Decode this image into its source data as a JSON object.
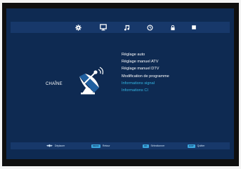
{
  "screen": {
    "section_label": "CHAÎNE"
  },
  "top_icons": [
    "settings-icon",
    "tv-icon",
    "music-icon",
    "clock-icon",
    "lock-icon",
    "input-source-icon"
  ],
  "menu": {
    "items": [
      {
        "label": "Réglage auto",
        "active": false
      },
      {
        "label": "Réglage manuel ATV",
        "active": false
      },
      {
        "label": "Réglage manuel DTV",
        "active": false
      },
      {
        "label": "Modification de programme",
        "active": false
      },
      {
        "label": "Informations signal",
        "active": true
      },
      {
        "label": "Informations CI",
        "active": true
      }
    ]
  },
  "footer": {
    "move_label": "Déplacer",
    "back_key": "MENU",
    "back_label": "Retour",
    "select_key": "OK",
    "select_label": "Sélectionner",
    "exit_key": "EXIT",
    "exit_label": "Quitter"
  },
  "colors": {
    "background": "#0e2a52",
    "bar": "#17386a",
    "highlight": "#34b7e6",
    "text": "#ffffff"
  }
}
